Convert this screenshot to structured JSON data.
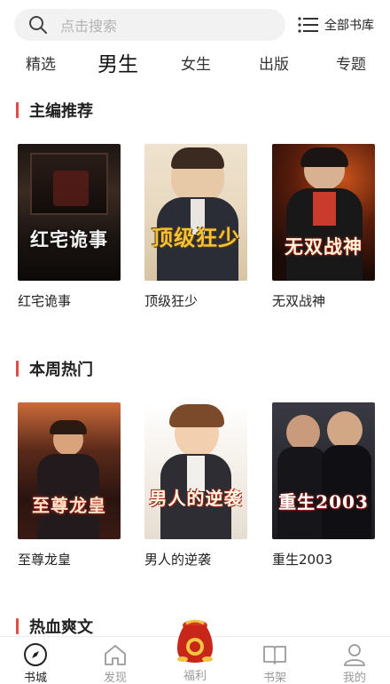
{
  "search": {
    "placeholder": "点击搜索"
  },
  "header": {
    "all_books": "全部书库"
  },
  "tabs": [
    "精选",
    "男生",
    "女生",
    "出版",
    "专题"
  ],
  "sections": [
    {
      "title": "主编推荐"
    },
    {
      "title": "本周热门"
    },
    {
      "title": "热血爽文"
    }
  ],
  "books_editor": [
    {
      "name": "红宅诡事",
      "cover_title": "红宅诡事"
    },
    {
      "name": "顶级狂少",
      "cover_title": "顶级狂少"
    },
    {
      "name": "无双战神",
      "cover_title": "无双战神"
    }
  ],
  "books_weekly": [
    {
      "name": "至尊龙皇",
      "cover_title": "至尊龙皇"
    },
    {
      "name": "男人的逆袭",
      "cover_title": "男人的逆袭"
    },
    {
      "name": "重生2003",
      "cover_title": "重生2003"
    }
  ],
  "nav": [
    "书城",
    "发现",
    "福利",
    "书架",
    "我的"
  ],
  "colors": {
    "accent": "#e34b4b",
    "placeholder": "#b3b3b3",
    "nav_inactive": "#999999"
  }
}
